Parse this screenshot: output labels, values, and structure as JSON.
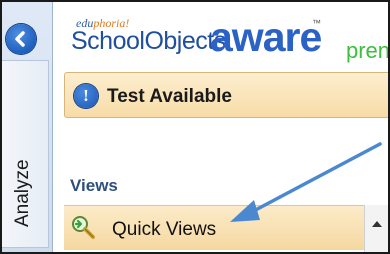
{
  "logo": {
    "small_prefix": "edu",
    "small_accent": "phoria!",
    "main": "SchoolObjects",
    "brand": "aware",
    "trademark": "™",
    "edition": "pren"
  },
  "sidebar": {
    "tab_label": "Analyze"
  },
  "banner": {
    "icon_glyph": "!",
    "text": "Test Available"
  },
  "views": {
    "heading": "Views",
    "items": [
      {
        "label": "Quick Views",
        "icon": "quick-views-magnifier-icon"
      }
    ]
  },
  "colors": {
    "banner_bg": "#f7dca7",
    "accent_blue": "#2b62c6",
    "arrow": "#4a88d0"
  }
}
